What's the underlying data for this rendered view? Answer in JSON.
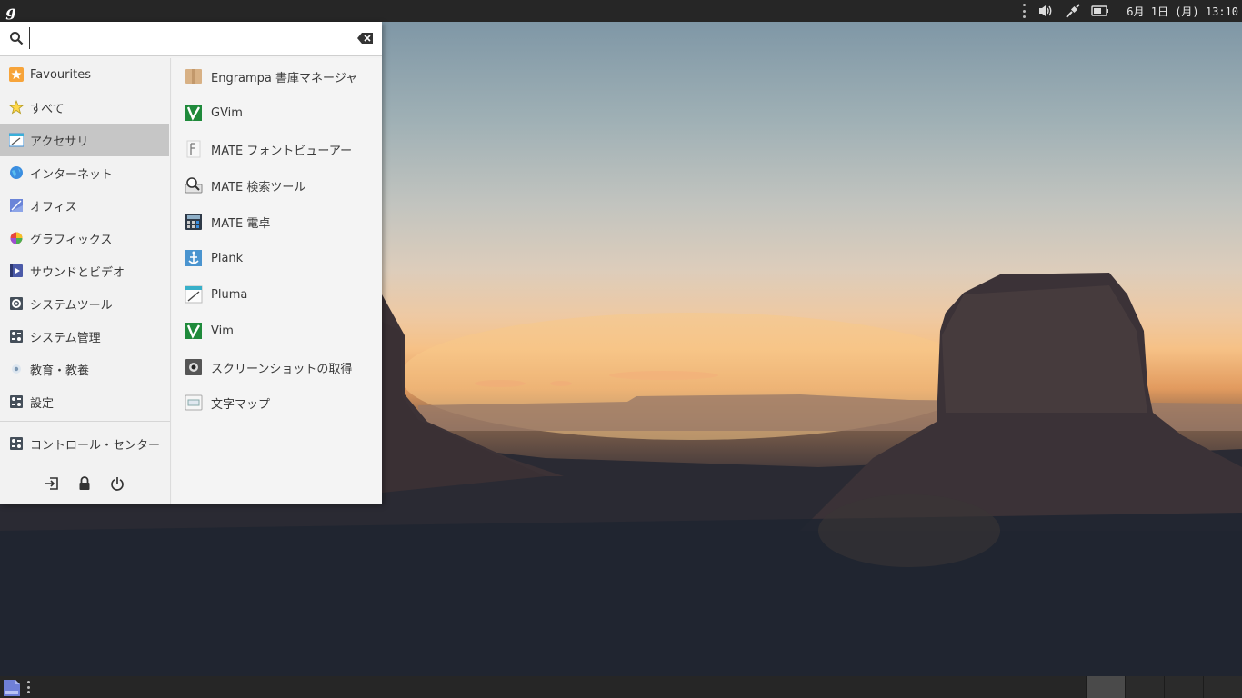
{
  "top_panel": {
    "menu_logo_glyph": "g",
    "clock": "6月 1日 (月) 13:10"
  },
  "search": {
    "value": "",
    "placeholder": ""
  },
  "categories": [
    {
      "label": "Favourites",
      "icon": "star-orange-icon"
    },
    {
      "label": "すべて",
      "icon": "star-outline-icon"
    },
    {
      "label": "アクセサリ",
      "icon": "accessories-icon"
    },
    {
      "label": "インターネット",
      "icon": "globe-icon"
    },
    {
      "label": "オフィス",
      "icon": "office-icon"
    },
    {
      "label": "グラフィックス",
      "icon": "graphics-icon"
    },
    {
      "label": "サウンドとビデオ",
      "icon": "multimedia-icon"
    },
    {
      "label": "システムツール",
      "icon": "system-tools-icon"
    },
    {
      "label": "システム管理",
      "icon": "system-admin-icon"
    },
    {
      "label": "教育・教養",
      "icon": "education-icon"
    },
    {
      "label": "設定",
      "icon": "settings-icon"
    },
    {
      "label": "コントロール・センター",
      "icon": "control-center-icon"
    }
  ],
  "selected_category": "アクセサリ",
  "apps": [
    {
      "label": "Engrampa 書庫マネージャ",
      "icon": "archive-manager-icon"
    },
    {
      "label": "GVim",
      "icon": "gvim-icon"
    },
    {
      "label": "MATE フォントビューアー",
      "icon": "font-viewer-icon"
    },
    {
      "label": "MATE 検索ツール",
      "icon": "search-tool-icon"
    },
    {
      "label": "MATE 電卓",
      "icon": "calculator-icon"
    },
    {
      "label": "Plank",
      "icon": "plank-icon"
    },
    {
      "label": "Pluma",
      "icon": "pluma-icon"
    },
    {
      "label": "Vim",
      "icon": "vim-icon"
    },
    {
      "label": "スクリーンショットの取得",
      "icon": "screenshot-icon"
    },
    {
      "label": "文字マップ",
      "icon": "character-map-icon"
    }
  ],
  "session_buttons": [
    "logout-icon",
    "lock-icon",
    "power-icon"
  ],
  "colors": {
    "panel": "#262626",
    "menu_bg": "#f2f2f2",
    "selected_bg": "#c6c6c6"
  }
}
